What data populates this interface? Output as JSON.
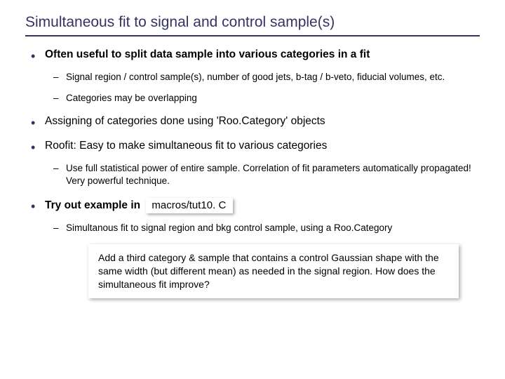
{
  "title": "Simultaneous fit to signal and control sample(s)",
  "bullets": {
    "b1": "Often useful to split data sample into various categories in a fit",
    "b1_sub1": "Signal region / control sample(s), number of good jets, b-tag / b-veto, fiducial volumes, etc.",
    "b1_sub2": "Categories may be overlapping",
    "b2": "Assigning of categories done using 'Roo.Category' objects",
    "b3": "Roofit: Easy to make simultaneous fit to various categories",
    "b3_sub1": "Use full statistical power of entire sample. Correlation of fit parameters automatically propagated! Very powerful technique.",
    "b4_prefix": "Try out example in ",
    "b4_code": "macros/tut10. C",
    "b4_sub1": "Simultanous fit to signal region and bkg control sample, using a Roo.Category"
  },
  "note": "Add a third category & sample that contains a control Gaussian shape with the same width (but different mean) as needed in the signal region. How does the simultaneous fit improve?"
}
